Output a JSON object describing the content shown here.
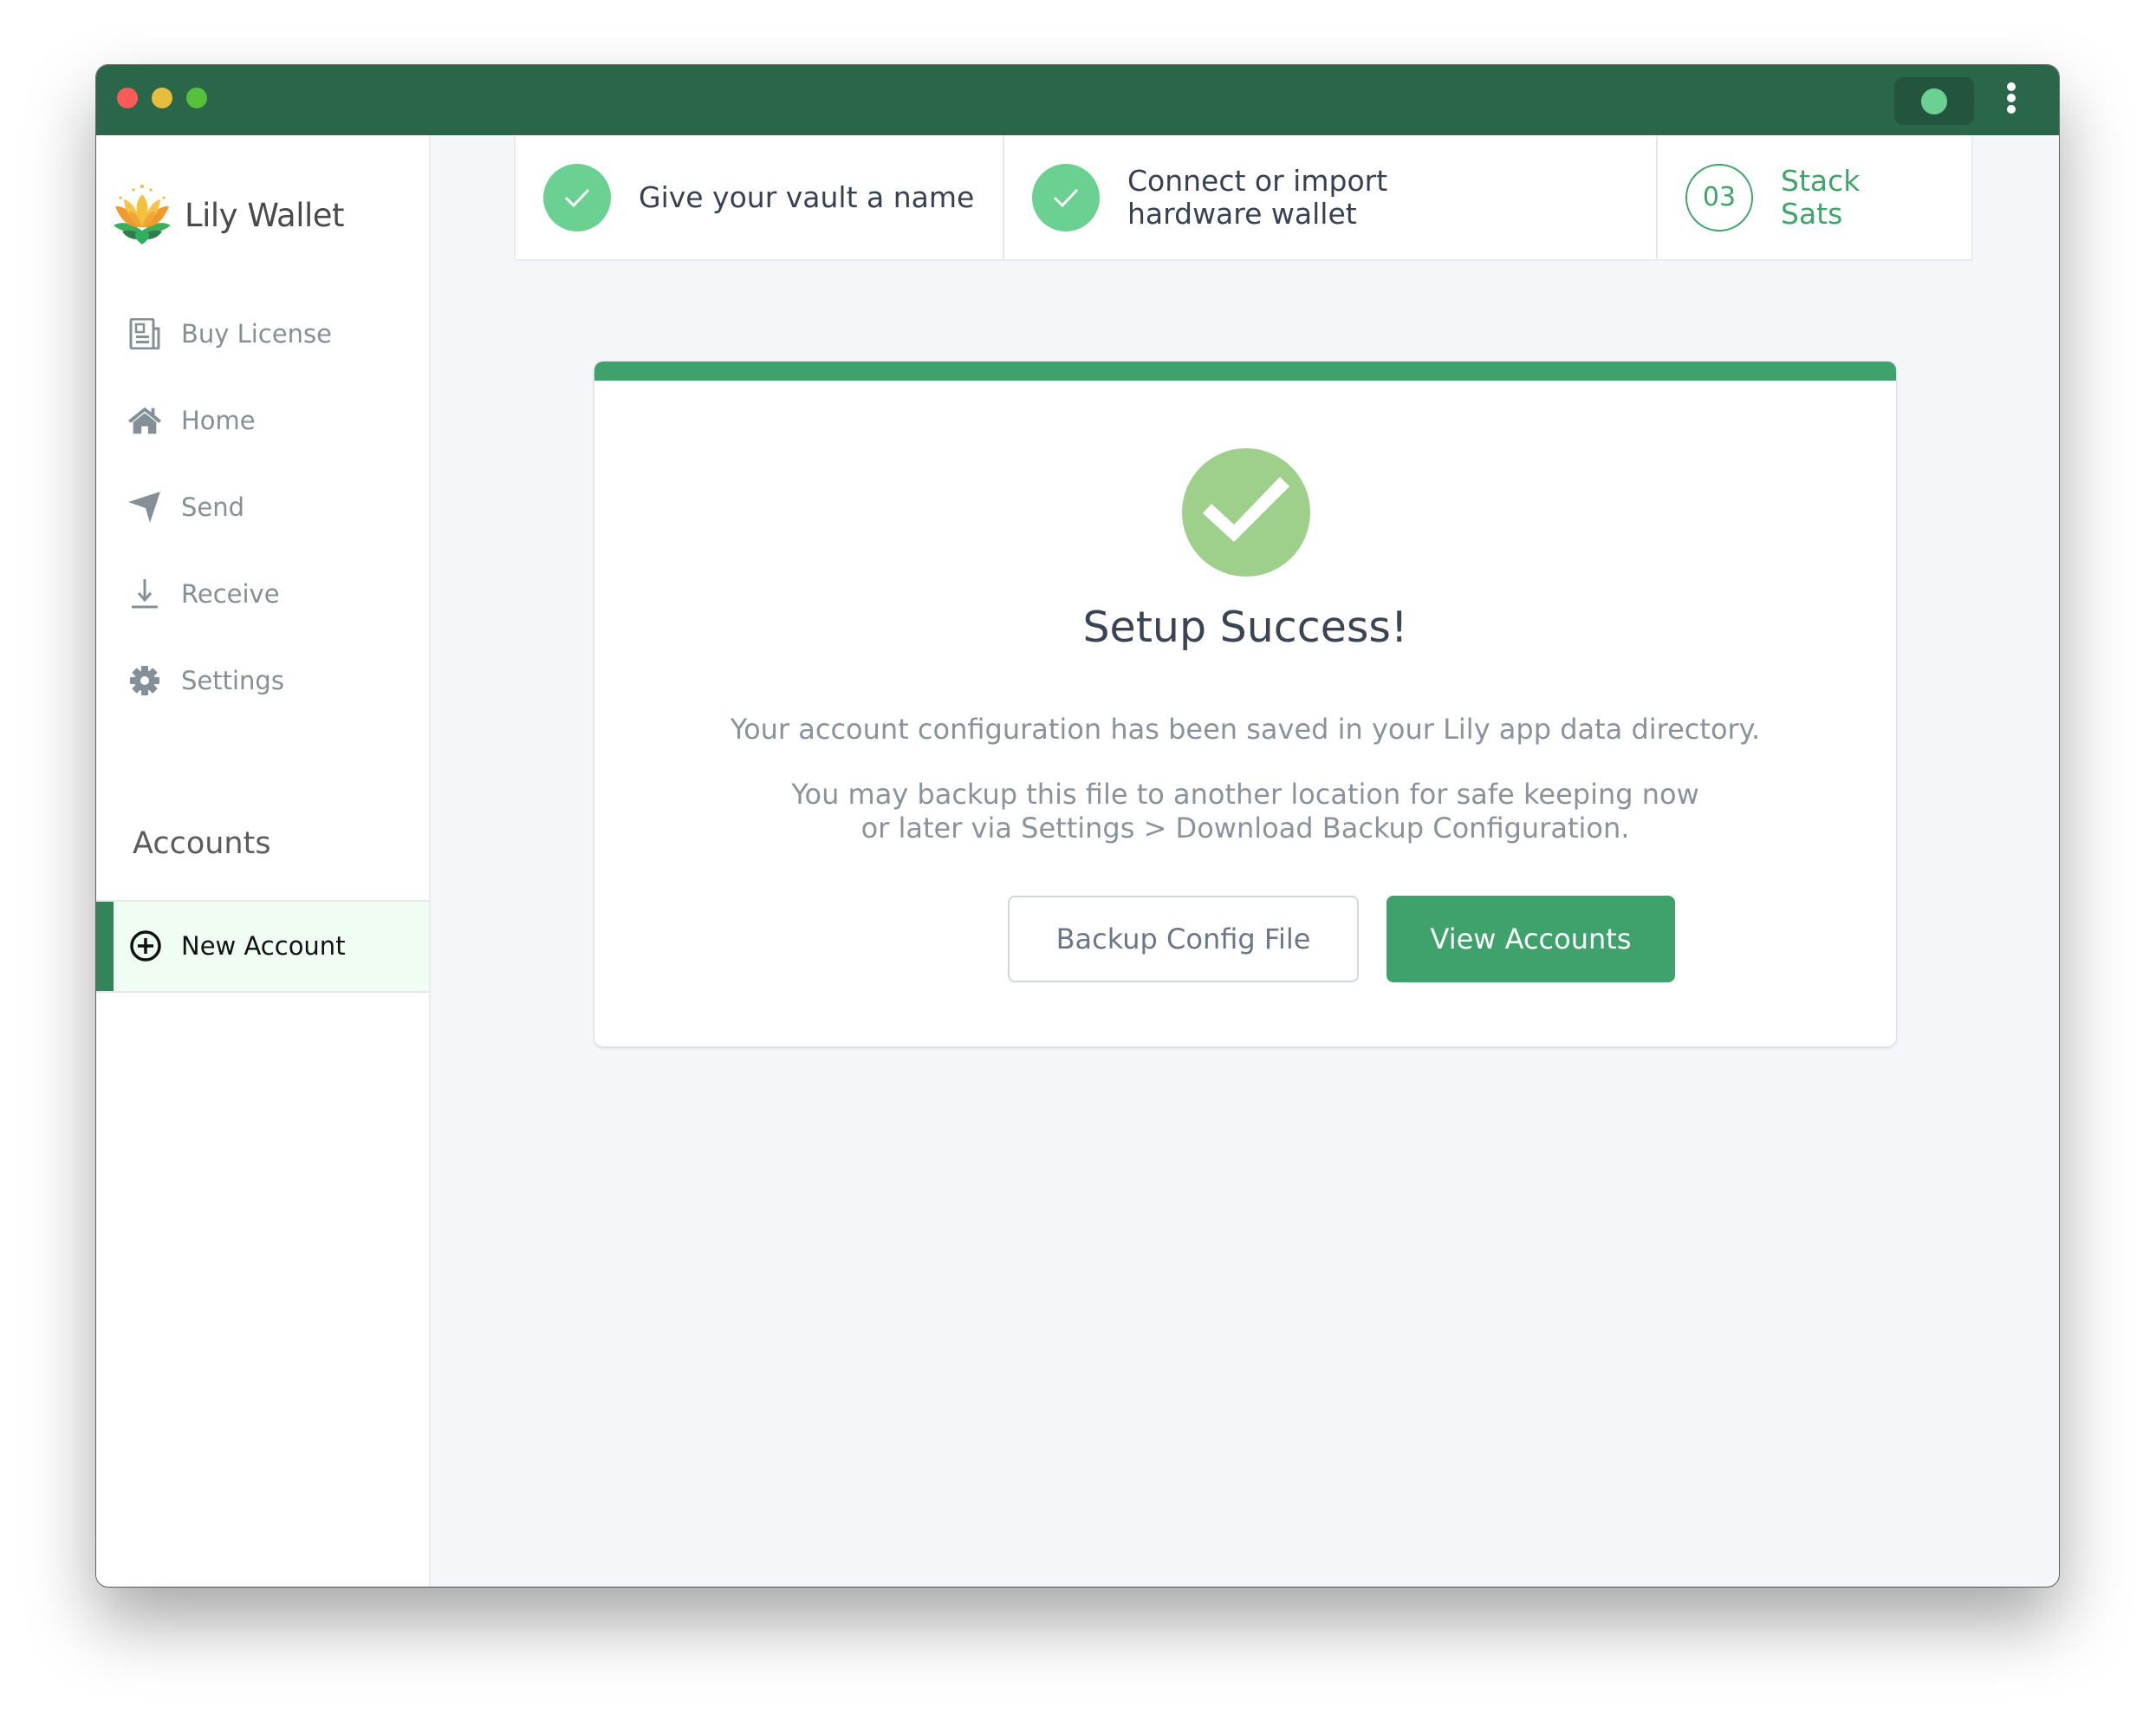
{
  "window": {
    "controls": [
      "close",
      "minimize",
      "maximize"
    ],
    "status_indicator_color": "#6bd193",
    "menu_icon": "kebab-vertical-icon"
  },
  "sidebar": {
    "app_name": "Lily Wallet",
    "logo_icon": "lotus-flower-logo",
    "items": [
      {
        "label": "Buy License",
        "icon": "newspaper-icon"
      },
      {
        "label": "Home",
        "icon": "home-icon"
      },
      {
        "label": "Send",
        "icon": "paper-plane-icon"
      },
      {
        "label": "Receive",
        "icon": "download-icon"
      },
      {
        "label": "Settings",
        "icon": "gear-icon"
      }
    ],
    "accounts_heading": "Accounts",
    "new_account": {
      "label": "New Account",
      "icon": "plus-circle-icon",
      "active": true
    }
  },
  "steps": [
    {
      "label": "Give your vault a name",
      "status": "complete"
    },
    {
      "label": "Connect or import hardware wallet",
      "status": "complete"
    },
    {
      "number": "03",
      "label": "Stack Sats",
      "status": "current"
    }
  ],
  "card": {
    "icon": "check-circle-icon",
    "title": "Setup Success!",
    "message": "Your account configuration has been saved in your Lily app data directory.",
    "note_line1": "You may backup this file to another location for safe keeping now",
    "note_line2": "or later via Settings > Download Backup Configuration.",
    "buttons": {
      "backup": "Backup Config File",
      "view_accounts": "View Accounts"
    }
  },
  "colors": {
    "titlebar": "#2a664a",
    "accent": "#3fa16b",
    "step_complete": "#6bd193",
    "success_icon": "#9ed08b"
  }
}
